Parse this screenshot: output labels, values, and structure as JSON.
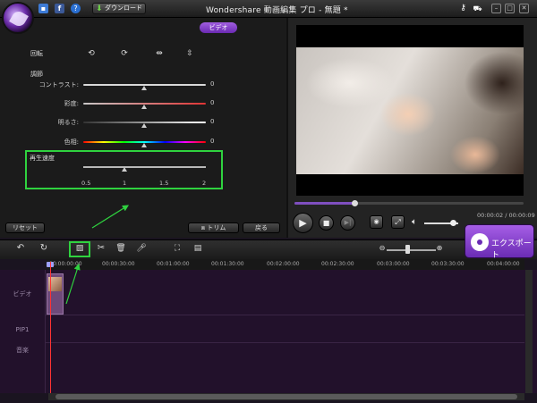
{
  "window": {
    "title": "Wondershare 動画編集 プロ - 無題 *",
    "download_label": "ダウンロード"
  },
  "left_panel": {
    "tab_label": "ビデオ",
    "rotation_label": "回転",
    "adjust_label": "調節",
    "sliders": [
      {
        "name": "コントラスト:",
        "value": "0",
        "color": "#d8d8d8"
      },
      {
        "name": "彩度:",
        "value": "0",
        "color": "#e03434"
      },
      {
        "name": "明るさ:",
        "value": "0",
        "color": "#ffffff"
      },
      {
        "name": "色相:",
        "value": "0",
        "color": "rainbow"
      }
    ],
    "speed": {
      "label": "再生速度",
      "ticks": [
        "0.5",
        "1",
        "1.5",
        "2"
      ],
      "current": "1"
    },
    "reset_label": "リセット",
    "trim_label": "トリム",
    "back_label": "戻る"
  },
  "preview": {
    "time": "00:00:02 / 00:00:09",
    "progress": 0.26,
    "volume": 0.85
  },
  "export_label": "エクスポート",
  "timeline": {
    "ruler": [
      "00:00:00:00",
      "00:00:30:00",
      "00:01:00:00",
      "00:01:30:00",
      "00:02:00:00",
      "00:02:30:00",
      "00:03:00:00",
      "00:03:30:00",
      "00:04:00:00"
    ],
    "tracks": [
      "ビデオ",
      "PIP1",
      "音楽"
    ]
  }
}
